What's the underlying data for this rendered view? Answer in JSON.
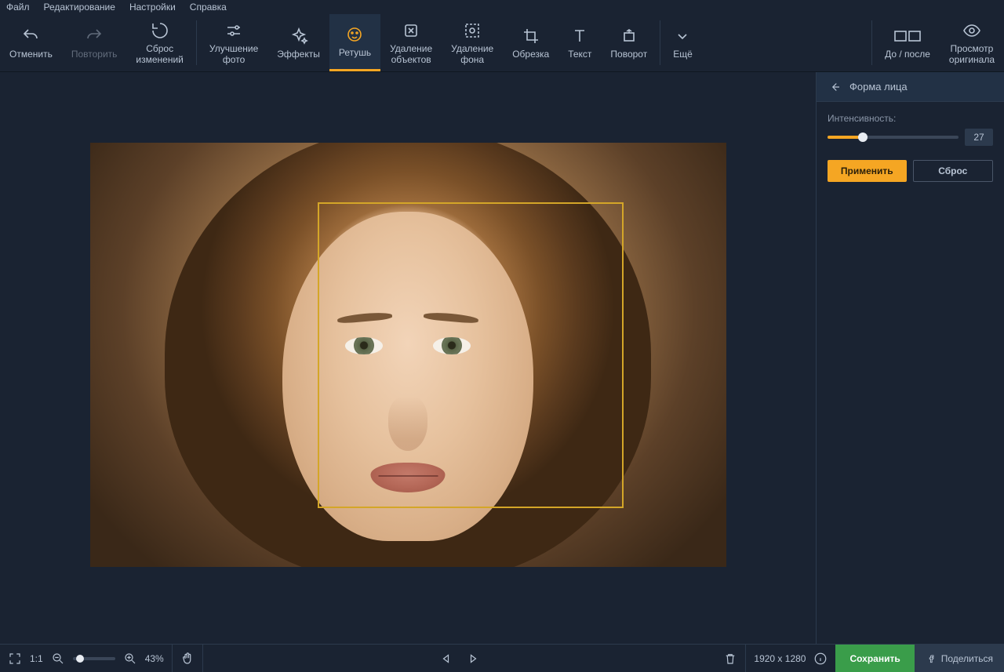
{
  "menu": {
    "file": "Файл",
    "edit": "Редактирование",
    "settings": "Настройки",
    "help": "Справка"
  },
  "toolbar": {
    "undo": "Отменить",
    "redo": "Повторить",
    "reset": "Сброс\nизменений",
    "enhance": "Улучшение\nфото",
    "effects": "Эффекты",
    "retouch": "Ретушь",
    "delobj": "Удаление\nобъектов",
    "delbg": "Удаление\nфона",
    "crop": "Обрезка",
    "text": "Текст",
    "rotate": "Поворот",
    "more": "Ещё",
    "before_after": "До / после",
    "view_orig": "Просмотр\nоригинала"
  },
  "panel": {
    "title": "Форма лица",
    "intensity_label": "Интенсивность:",
    "intensity_value": "27",
    "intensity_pct": 27,
    "apply": "Применить",
    "reset": "Сброс"
  },
  "status": {
    "scale_11": "1:1",
    "zoom_pct": "43%",
    "dimensions": "1920 x 1280",
    "save": "Сохранить",
    "share": "Поделиться"
  }
}
